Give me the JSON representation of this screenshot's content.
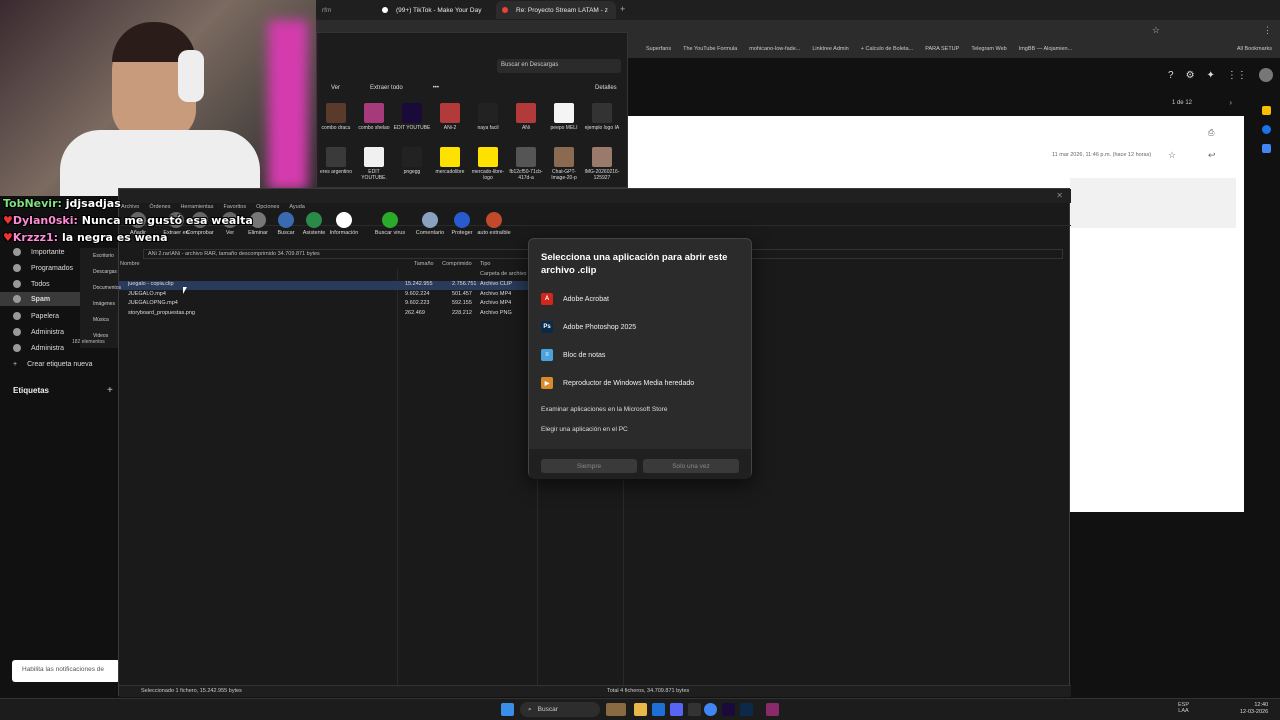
{
  "chrome": {
    "tabs": [
      {
        "label": "(99+) TikTok - Make Your Day",
        "active": false
      },
      {
        "label": "Re: Proyecto Stream LATAM - z",
        "active": true
      }
    ],
    "partial_tab": "rfm",
    "bookmarks": [
      "Superfans",
      "The YouTube Formula",
      "mohicano-low-fade...",
      "Linktree Admin",
      "+ Calculo de Boleta...",
      "PARA SETUP",
      "Telegram Web",
      "ImgBB — Alojamien..."
    ],
    "all_bookmarks": "All Bookmarks"
  },
  "gmail": {
    "sidebar": [
      "Importante",
      "Programados",
      "Todos",
      "Spam",
      "Papelera",
      "Administra",
      "Administra",
      "Crear etiqueta nueva"
    ],
    "labels_heading": "Etiquetas",
    "pagination": "1 de 12",
    "timestamp": "11 mar 2026, 11:46 p.m. (hace 12 horas)",
    "notification_banner": "Habilita las notificaciones de"
  },
  "explorer": {
    "search_placeholder": "Buscar en Descargas",
    "view_label": "Ver",
    "extract_label": "Extraer todo",
    "details_label": "Detalles",
    "nav": [
      "Escritorio",
      "Descargas",
      "Documentos",
      "Imágenes",
      "Música",
      "Videos"
    ],
    "count": "182 elementos",
    "files_row1": [
      "combo dracu",
      "combo shelao",
      "EDIT YOUTUBE",
      "ANi-2",
      "naya facil",
      "ANi",
      "peepo MELI",
      "ejemplo logo IA"
    ],
    "files_row2": [
      "eres argentino",
      "EDIT YOUTUBE.",
      "pngegg",
      "mercadolibre",
      "mercado-libre-logo",
      "fb12cf50-71cb-417d-a",
      "Chat-GPT-Image-20-p",
      "IMG-20260216-125927"
    ]
  },
  "winrar": {
    "menu": [
      "Archivo",
      "Órdenes",
      "Herramientas",
      "Favoritos",
      "Opciones",
      "Ayuda"
    ],
    "tools": [
      "Añadir",
      "Extraer en",
      "Comprobar",
      "Ver",
      "Eliminar",
      "Buscar",
      "Asistente",
      "Información",
      "Buscar virus",
      "Comentario",
      "Proteger",
      "auto extraíble"
    ],
    "path": "ANi 2.rar\\ANi - archivo RAR, tamaño descomprimido 34.709.871 bytes",
    "columns": [
      "Nombre",
      "Tamaño",
      "Comprimido",
      "Tipo"
    ],
    "parent_type": "Carpeta de archivo",
    "files": [
      {
        "name": "juegalo - copia.clip",
        "size": "15.242.955",
        "packed": "2.756.751",
        "type": "Archivo CLIP"
      },
      {
        "name": "JUEGALO.mp4",
        "size": "9.602.224",
        "packed": "501.457",
        "type": "Archivo MP4"
      },
      {
        "name": "JUEGALOPNG.mp4",
        "size": "9.602.223",
        "packed": "592.155",
        "type": "Archivo MP4"
      },
      {
        "name": "storyboard_propuestas.png",
        "size": "262.469",
        "packed": "228.212",
        "type": "Archivo PNG"
      }
    ],
    "status_left": "Seleccionado 1 fichero, 15.242.955 bytes",
    "status_right": "Total 4 ficheros, 34.709.871 bytes"
  },
  "dialog": {
    "title": "Selecciona una aplicación para abrir este archivo .clip",
    "apps": [
      {
        "name": "Adobe Acrobat",
        "color": "#d4251c",
        "glyph": "A"
      },
      {
        "name": "Adobe Photoshop 2025",
        "color": "#0b2a4a",
        "glyph": "Ps"
      },
      {
        "name": "Bloc de notas",
        "color": "#4aa3df",
        "glyph": "≡"
      },
      {
        "name": "Reproductor de Windows Media heredado",
        "color": "#d98a2b",
        "glyph": "▶"
      }
    ],
    "store_link": "Examinar aplicaciones en la Microsoft Store",
    "pc_link": "Elegir una aplicación en el PC",
    "always": "Siempre",
    "once": "Solo una vez"
  },
  "chat": [
    {
      "user": "TobNevir:",
      "msg": "jdjsadjas",
      "color": "#7ee07e"
    },
    {
      "user": "Dylan0ski:",
      "msg": "Nunca me gustó esa wealta",
      "color": "#ff8ad8"
    },
    {
      "user": "Krzzz1:",
      "msg": "la negra es wena",
      "color": "#ff8ad8"
    }
  ],
  "taskbar": {
    "search": "Buscar",
    "lang": "ESP",
    "lang2": "LAA",
    "time": "12:40",
    "date": "12-03-2026"
  }
}
